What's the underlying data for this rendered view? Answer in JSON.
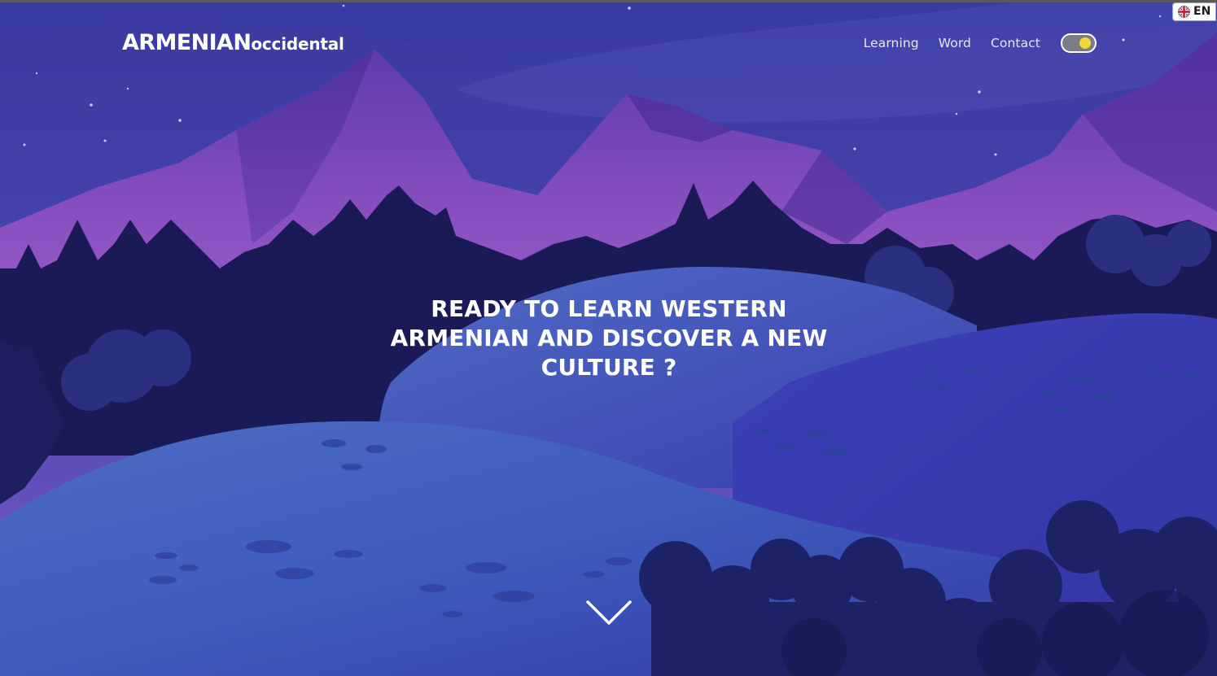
{
  "brand": {
    "main": "ARMENIAN",
    "sub": "occidental"
  },
  "nav": {
    "items": [
      {
        "label": "Learning"
      },
      {
        "label": "Word"
      },
      {
        "label": "Contact"
      }
    ],
    "theme_toggle": {
      "state": "on"
    }
  },
  "language": {
    "code": "EN",
    "flag_icon": "uk-flag-icon"
  },
  "hero": {
    "line1": "READY TO LEARN WESTERN",
    "line2": "ARMENIAN AND DISCOVER A NEW",
    "line3": "CULTURE ?"
  },
  "scroll_icon": "chevron-down-icon",
  "colors": {
    "sky_top": "#3a3a9c",
    "sky_glow": "#8a55c4",
    "hill_light": "#3e5fc0",
    "toggle_knob": "#f3d73a"
  }
}
